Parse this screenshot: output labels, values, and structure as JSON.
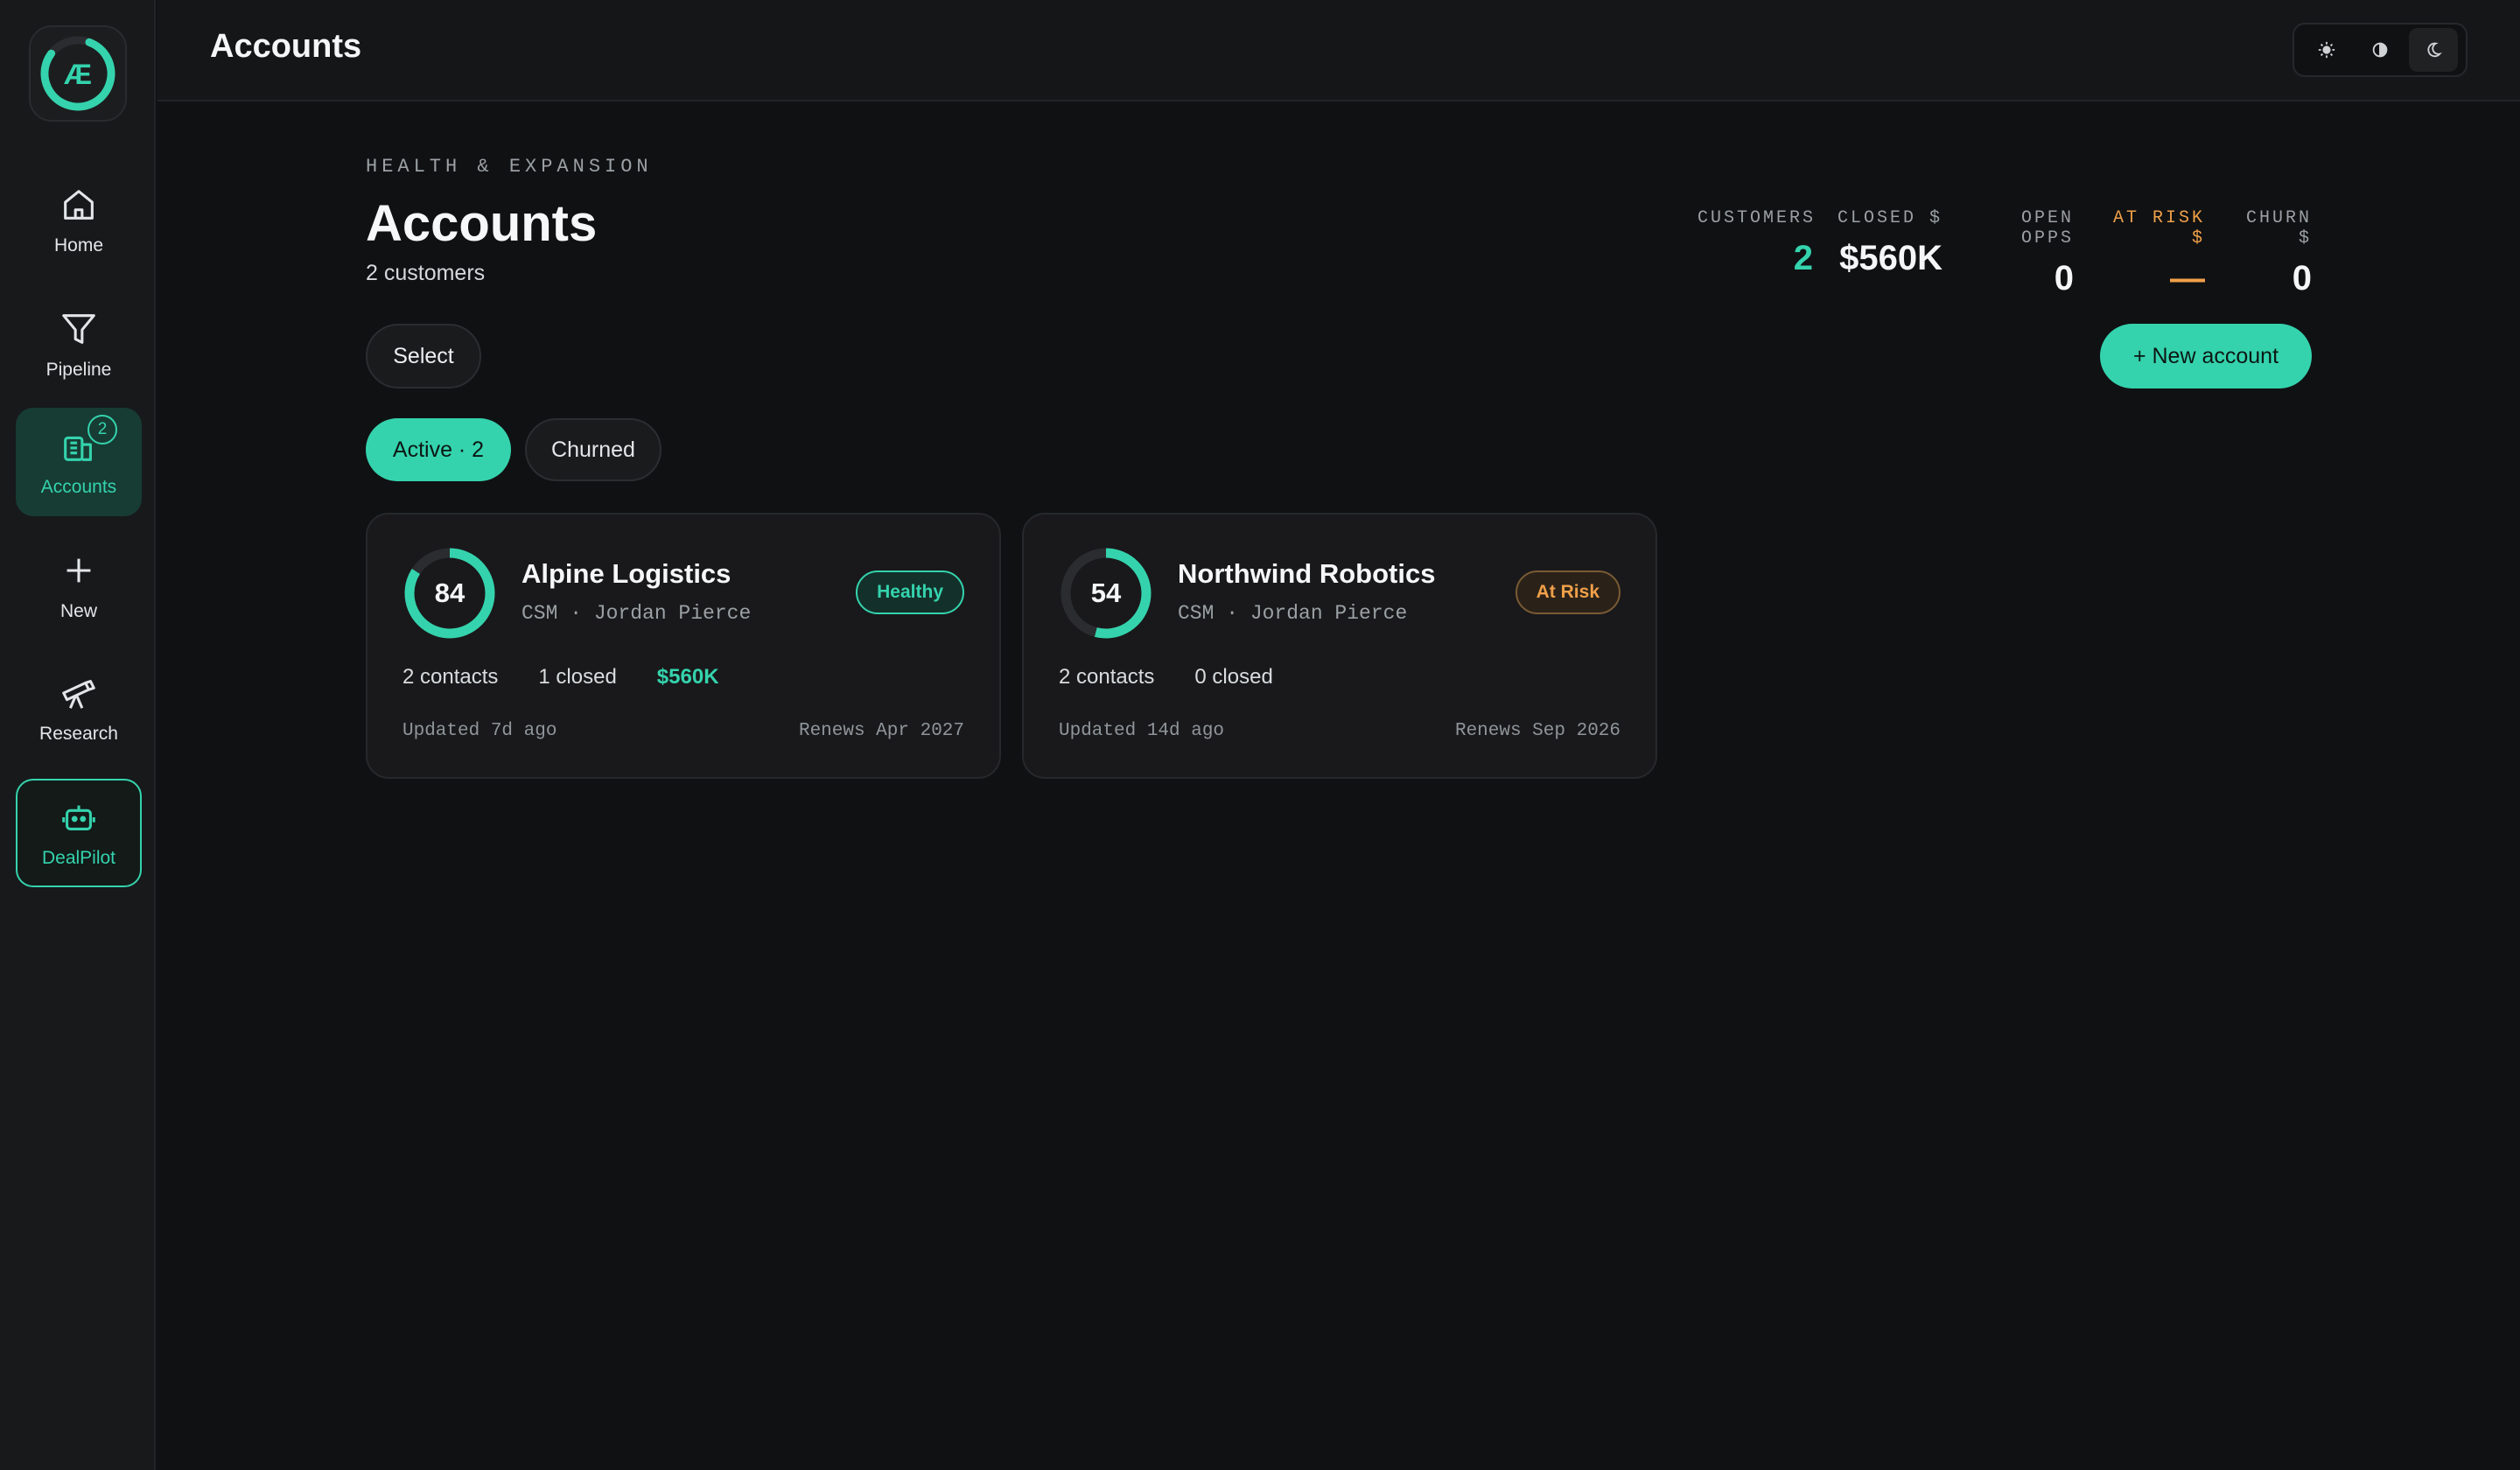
{
  "app": {
    "logo_text": "Æ",
    "topbar_title": "Accounts",
    "theme": {
      "light_icon": "sun-icon",
      "contrast_icon": "contrast-icon",
      "dark_icon": "moon-icon",
      "selected": "dark"
    }
  },
  "sidebar": {
    "items": [
      {
        "label": "Home",
        "icon": "home-icon"
      },
      {
        "label": "Pipeline",
        "icon": "filter-icon"
      },
      {
        "label": "Accounts",
        "icon": "building-icon",
        "badge": "2",
        "active": true
      },
      {
        "label": "New",
        "icon": "plus-icon"
      },
      {
        "label": "Research",
        "icon": "telescope-icon"
      },
      {
        "label": "DealPilot",
        "icon": "robot-icon"
      }
    ]
  },
  "header": {
    "eyebrow": "HEALTH & EXPANSION",
    "title": "Accounts",
    "subtitle": "2 customers",
    "select_label": "Select",
    "new_account_label": "+ New account"
  },
  "stats": [
    {
      "label": "CUSTOMERS",
      "value": "2"
    },
    {
      "label": "CLOSED $",
      "value": "$560K"
    },
    {
      "label": "OPEN OPPS",
      "value": "0"
    },
    {
      "label": "AT RISK $",
      "value": "—"
    },
    {
      "label": "CHURN $",
      "value": "0"
    }
  ],
  "tabs": [
    {
      "label": "Active · 2",
      "active": true
    },
    {
      "label": "Churned",
      "active": false
    }
  ],
  "accounts": [
    {
      "score": "84",
      "score_fraction": 0.84,
      "name": "Alpine Logistics",
      "csm": "CSM · Jordan Pierce",
      "status": "Healthy",
      "contacts": "2 contacts",
      "closed": "1 closed",
      "value": "$560K",
      "updated": "Updated 7d ago",
      "renews": "Renews Apr 2027"
    },
    {
      "score": "54",
      "score_fraction": 0.54,
      "name": "Northwind Robotics",
      "csm": "CSM · Jordan Pierce",
      "status": "At Risk",
      "contacts": "2 contacts",
      "closed": "0 closed",
      "value": "",
      "updated": "Updated 14d ago",
      "renews": "Renews Sep 2026"
    }
  ],
  "colors": {
    "accent": "#34d3ad",
    "warning": "#f0a049",
    "background": "#101113",
    "surface": "#19191b"
  }
}
